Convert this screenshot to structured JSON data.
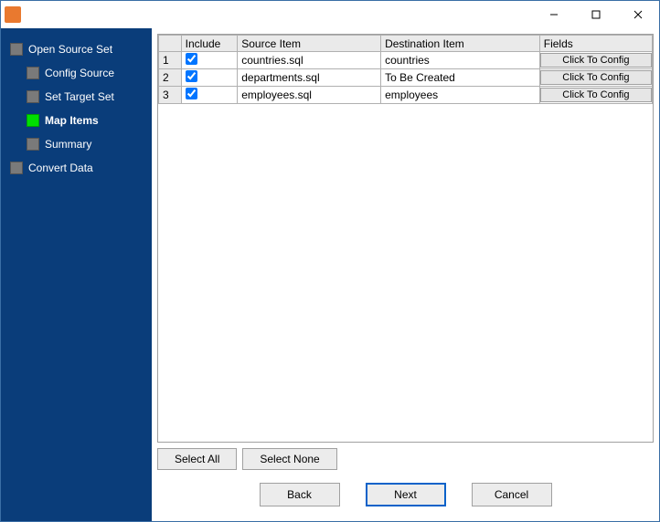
{
  "titlebar": {
    "minimize_title": "Minimize",
    "maximize_title": "Maximize",
    "close_title": "Close"
  },
  "sidebar": {
    "items": [
      {
        "label": "Open Source Set",
        "level": 0,
        "active": false
      },
      {
        "label": "Config Source",
        "level": 1,
        "active": false
      },
      {
        "label": "Set Target Set",
        "level": 1,
        "active": false
      },
      {
        "label": "Map Items",
        "level": 1,
        "active": true
      },
      {
        "label": "Summary",
        "level": 1,
        "active": false
      },
      {
        "label": "Convert Data",
        "level": 0,
        "active": false
      }
    ]
  },
  "table": {
    "columns": {
      "rownum": "",
      "include": "Include",
      "source": "Source Item",
      "destination": "Destination Item",
      "fields": "Fields"
    },
    "config_btn_label": "Click To Config",
    "rows": [
      {
        "num": "1",
        "include": true,
        "source": "countries.sql",
        "destination": "countries",
        "new_dest": false
      },
      {
        "num": "2",
        "include": true,
        "source": "departments.sql",
        "destination": "To Be Created",
        "new_dest": true
      },
      {
        "num": "3",
        "include": true,
        "source": "employees.sql",
        "destination": "employees",
        "new_dest": false
      }
    ]
  },
  "selection_buttons": {
    "select_all": "Select All",
    "select_none": "Select None"
  },
  "wizard_buttons": {
    "back": "Back",
    "next": "Next",
    "cancel": "Cancel"
  }
}
